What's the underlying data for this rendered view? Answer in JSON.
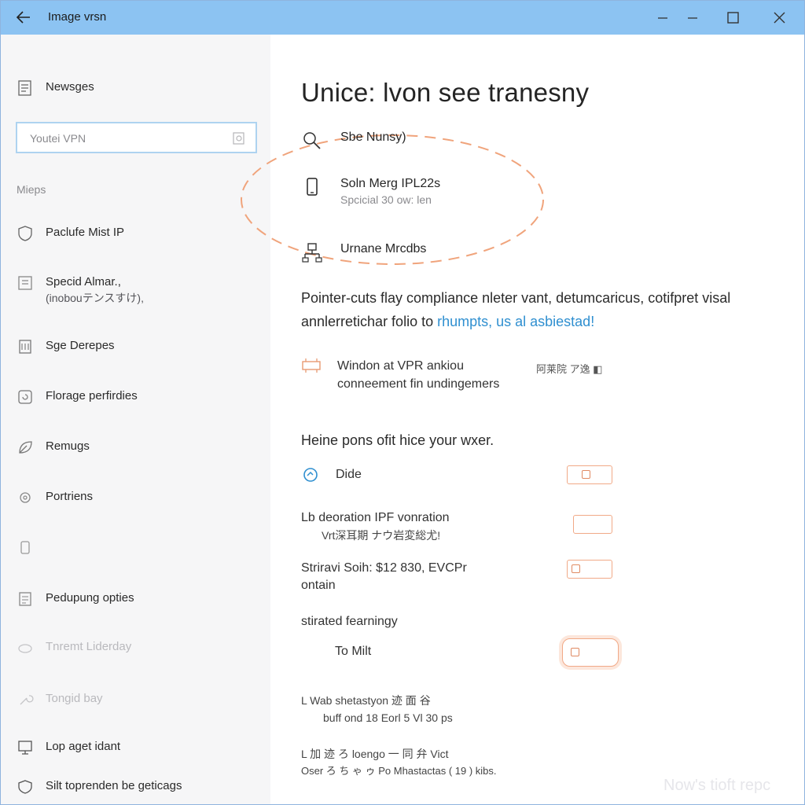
{
  "window": {
    "title": "Image vrsn",
    "colors": {
      "titlebar": "#8cc3f2",
      "sidebar": "#f6f6f7",
      "accent": "#2f8fd0",
      "toggle": "#f1a987",
      "dashed": "#f0a47c"
    }
  },
  "sidebar": {
    "top_item": {
      "label": "Newsges",
      "icon": "page-icon"
    },
    "search": {
      "value": "Youtei VPN",
      "icon": "search-icon"
    },
    "section_label": "Mieps",
    "items": [
      {
        "label": "Paclufe Mist IP",
        "icon": "shield-icon"
      },
      {
        "label": "Specid Almar.,",
        "sub": "(inobouテンスすけ),",
        "icon": "page-icon"
      },
      {
        "label": "Sge Derepes",
        "icon": "page-icon"
      },
      {
        "label": "Florage perfirdies",
        "icon": "refresh-icon"
      },
      {
        "label": "Remugs",
        "icon": "leaf-icon"
      },
      {
        "label": "Portriens",
        "icon": "gear-icon"
      },
      {
        "label": "",
        "icon": "device-icon"
      },
      {
        "label": "Pedupung opties",
        "icon": "page-icon"
      },
      {
        "label": "Tnremt Liderday",
        "icon": "cloud-icon"
      },
      {
        "label": "Tongid bay",
        "icon": "wrench-icon"
      },
      {
        "label": "Lop aget idant",
        "icon": "monitor-icon"
      },
      {
        "label": "Silt toprenden be geticags",
        "icon": "shield-icon"
      }
    ]
  },
  "main": {
    "title": "Unice: lvon see tranesny",
    "options": [
      {
        "label": "Sbe  Nunsy)",
        "sub": "",
        "icon": "search-icon"
      },
      {
        "label": "Soln Merg  IPL22s",
        "sub": "Spcicial 30 ow: len",
        "icon": "phone-icon"
      },
      {
        "label": "Urnane Mrcdbs",
        "sub": "",
        "icon": "network-icon"
      }
    ],
    "paragraph": {
      "text": "Pointer-cuts flay compliance nleter vant, detumcaricus, cotifpret visal annlerretichar folio to ",
      "link": "rhumpts, us al asbiestad!"
    },
    "info": {
      "line1": "Windon at VPR ankiou",
      "line2": "conneement fin undingemers",
      "badge": "阿莱院 ア逸 ◧",
      "icon": "router-icon"
    },
    "section_title": "Heine pons ofit hice your wxer.",
    "settings": [
      {
        "label": "Dide",
        "sub": "",
        "icon": "refresh-icon",
        "toggle": "on"
      },
      {
        "label": "Lb deoration  IPF vonration",
        "sub": "Vrt深耳期 ナウ岩変総尤!",
        "icon": "",
        "toggle": "off"
      },
      {
        "label": "Striravi Soih: $12 830, EVCPr",
        "sub": "ontain",
        "icon": "",
        "toggle": "off"
      },
      {
        "label": "stirated fearningy",
        "sub": "",
        "icon": "",
        "toggle": ""
      },
      {
        "label": "To Milt",
        "sub": "",
        "icon": "",
        "toggle": "on"
      },
      {
        "label": "L Wab shetastyon 迹 面 谷",
        "sub": "buff ond 18 Eorl  5 Vl 30 ps",
        "icon": "",
        "toggle": ""
      },
      {
        "label": "L 加 迹 ろ loengo 一 同 弁 Vict",
        "sub": "Oser ろ ち ゃ ゥ Po Mhastactas ( 19 ) kibs.",
        "icon": "",
        "toggle": ""
      }
    ],
    "watermark": "Now's tioft repc"
  }
}
